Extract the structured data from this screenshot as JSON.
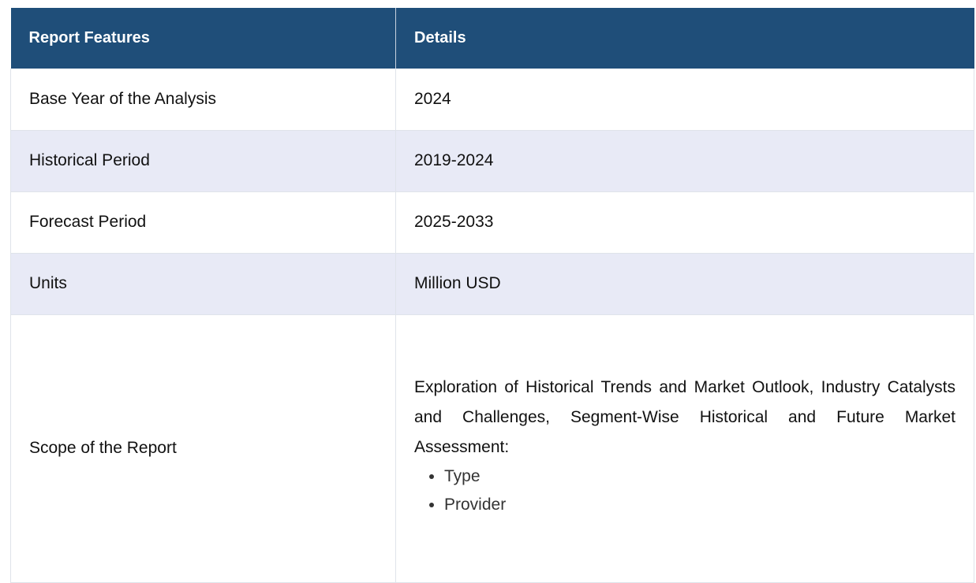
{
  "table": {
    "headers": [
      "Report Features",
      "Details"
    ],
    "rows": [
      {
        "feature": "Base Year of the Analysis",
        "detail": "2024"
      },
      {
        "feature": "Historical Period",
        "detail": "2019-2024"
      },
      {
        "feature": "Forecast Period",
        "detail": "2025-2033"
      },
      {
        "feature": "Units",
        "detail": "Million USD"
      }
    ],
    "scope": {
      "feature": "Scope of the Report",
      "text": "Exploration of Historical Trends and Market Outlook, Industry Catalysts and Challenges, Segment-Wise Historical and Future Market Assessment:",
      "items": [
        "Type",
        "Provider"
      ]
    }
  },
  "colors": {
    "header_bg": "#1f4e79",
    "alt_row_bg": "#e8eaf6"
  }
}
